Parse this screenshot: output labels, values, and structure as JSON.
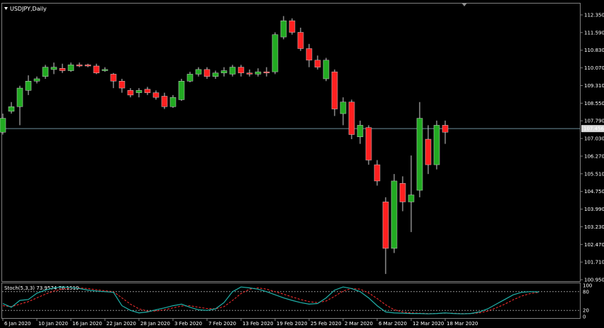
{
  "window": {
    "symbol_label": "USDJPY,Daily",
    "current_price_label": "107.456",
    "colors": {
      "background": "#000000",
      "frame": "#808080",
      "bull": "#22aa22",
      "bear": "#ff2020",
      "wick": "#d0d0d0",
      "price_line": "#6b8e9a",
      "stoch_main": "#20b2aa",
      "stoch_signal": "#ff3030",
      "level_line": "#909090",
      "text": "#ffffff",
      "current_badge_bg": "#d8d8d8",
      "current_badge_text": "#000000"
    }
  },
  "price_axis": {
    "labels": [
      "112.350",
      "111.590",
      "110.830",
      "110.070",
      "109.310",
      "108.550",
      "107.790",
      "107.456",
      "107.030",
      "106.270",
      "105.510",
      "104.750",
      "103.990",
      "103.230",
      "102.470",
      "101.710",
      "100.950"
    ],
    "min": 100.95,
    "max": 112.35,
    "current_price": 107.456
  },
  "date_axis": {
    "labels": [
      "6 Jan 2020",
      "10 Jan 2020",
      "16 Jan 2020",
      "22 Jan 2020",
      "28 Jan 2020",
      "3 Feb 2020",
      "7 Feb 2020",
      "13 Feb 2020",
      "19 Feb 2020",
      "25 Feb 2020",
      "2 Mar 2020",
      "6 Mar 2020",
      "12 Mar 2020",
      "18 Mar 2020"
    ],
    "label_bar_index": [
      0,
      4,
      8,
      12,
      16,
      20,
      24,
      28,
      32,
      36,
      40,
      44,
      48,
      52
    ]
  },
  "stochastic": {
    "label": "Stoch(5,3,3) 73.9574 76.1519",
    "levels_labels": [
      "100",
      "80",
      "20",
      "0"
    ],
    "upper_level": 80,
    "lower_level": 20,
    "main": [
      42,
      30,
      52,
      55,
      75,
      85,
      92,
      95,
      93,
      90,
      85,
      82,
      80,
      78,
      35,
      20,
      12,
      15,
      22,
      28,
      35,
      40,
      30,
      22,
      20,
      25,
      45,
      80,
      95,
      92,
      88,
      80,
      70,
      60,
      52,
      45,
      40,
      42,
      60,
      85,
      95,
      90,
      80,
      60,
      35,
      15,
      12,
      11,
      10,
      10,
      9,
      10,
      12,
      10,
      9,
      10,
      15,
      25,
      40,
      55,
      70,
      78,
      80,
      79
    ],
    "signal": [
      35,
      32,
      40,
      48,
      60,
      72,
      82,
      88,
      92,
      92,
      90,
      86,
      83,
      80,
      60,
      40,
      25,
      18,
      18,
      22,
      28,
      34,
      35,
      30,
      26,
      25,
      32,
      52,
      74,
      88,
      92,
      88,
      80,
      72,
      63,
      55,
      48,
      45,
      50,
      65,
      82,
      90,
      88,
      76,
      58,
      38,
      22,
      15,
      12,
      11,
      10,
      10,
      11,
      11,
      10,
      10,
      12,
      18,
      28,
      40,
      54,
      66,
      74,
      78
    ]
  },
  "chart_data": {
    "type": "candlestick",
    "title": "USDJPY,Daily",
    "ylim": [
      100.95,
      112.35
    ],
    "current_price": 107.456,
    "candles": [
      {
        "o": 107.3,
        "h": 108.1,
        "l": 107.2,
        "c": 107.9
      },
      {
        "o": 108.2,
        "h": 108.6,
        "l": 108.1,
        "c": 108.4
      },
      {
        "o": 108.4,
        "h": 109.3,
        "l": 107.6,
        "c": 109.2
      },
      {
        "o": 109.1,
        "h": 109.75,
        "l": 108.9,
        "c": 109.5
      },
      {
        "o": 109.5,
        "h": 109.7,
        "l": 109.4,
        "c": 109.6
      },
      {
        "o": 109.7,
        "h": 110.2,
        "l": 109.6,
        "c": 110.1
      },
      {
        "o": 110.0,
        "h": 110.3,
        "l": 109.8,
        "c": 110.1
      },
      {
        "o": 110.05,
        "h": 110.25,
        "l": 109.85,
        "c": 109.95
      },
      {
        "o": 109.95,
        "h": 110.3,
        "l": 109.9,
        "c": 110.2
      },
      {
        "o": 110.2,
        "h": 110.3,
        "l": 110.1,
        "c": 110.15
      },
      {
        "o": 110.2,
        "h": 110.25,
        "l": 110.1,
        "c": 110.15
      },
      {
        "o": 110.15,
        "h": 110.25,
        "l": 109.8,
        "c": 109.85
      },
      {
        "o": 109.95,
        "h": 110.1,
        "l": 109.9,
        "c": 110.0
      },
      {
        "o": 109.8,
        "h": 109.85,
        "l": 109.2,
        "c": 109.5
      },
      {
        "o": 109.5,
        "h": 109.6,
        "l": 109.0,
        "c": 109.2
      },
      {
        "o": 109.1,
        "h": 109.2,
        "l": 108.8,
        "c": 108.9
      },
      {
        "o": 109.0,
        "h": 109.2,
        "l": 108.8,
        "c": 109.1
      },
      {
        "o": 109.15,
        "h": 109.25,
        "l": 108.9,
        "c": 109.0
      },
      {
        "o": 109.0,
        "h": 109.1,
        "l": 108.7,
        "c": 108.8
      },
      {
        "o": 108.85,
        "h": 109.0,
        "l": 108.3,
        "c": 108.4
      },
      {
        "o": 108.4,
        "h": 108.9,
        "l": 108.35,
        "c": 108.8
      },
      {
        "o": 108.7,
        "h": 109.6,
        "l": 108.65,
        "c": 109.5
      },
      {
        "o": 109.5,
        "h": 109.9,
        "l": 109.45,
        "c": 109.8
      },
      {
        "o": 109.8,
        "h": 110.1,
        "l": 109.7,
        "c": 110.0
      },
      {
        "o": 110.0,
        "h": 110.1,
        "l": 109.6,
        "c": 109.7
      },
      {
        "o": 109.7,
        "h": 109.95,
        "l": 109.6,
        "c": 109.85
      },
      {
        "o": 109.85,
        "h": 110.1,
        "l": 109.7,
        "c": 109.95
      },
      {
        "o": 109.8,
        "h": 110.2,
        "l": 109.7,
        "c": 110.1
      },
      {
        "o": 110.1,
        "h": 110.2,
        "l": 109.7,
        "c": 109.85
      },
      {
        "o": 109.85,
        "h": 110.0,
        "l": 109.7,
        "c": 109.8
      },
      {
        "o": 109.8,
        "h": 110.05,
        "l": 109.7,
        "c": 109.9
      },
      {
        "o": 109.9,
        "h": 110.1,
        "l": 109.7,
        "c": 109.85
      },
      {
        "o": 109.9,
        "h": 111.6,
        "l": 109.8,
        "c": 111.5
      },
      {
        "o": 111.4,
        "h": 112.3,
        "l": 111.3,
        "c": 112.1
      },
      {
        "o": 112.1,
        "h": 112.2,
        "l": 111.5,
        "c": 111.6
      },
      {
        "o": 111.6,
        "h": 111.8,
        "l": 110.8,
        "c": 110.9
      },
      {
        "o": 110.9,
        "h": 111.1,
        "l": 110.1,
        "c": 110.4
      },
      {
        "o": 110.4,
        "h": 110.6,
        "l": 110.0,
        "c": 110.1
      },
      {
        "o": 109.6,
        "h": 110.5,
        "l": 109.5,
        "c": 110.4
      },
      {
        "o": 109.9,
        "h": 110.0,
        "l": 108.0,
        "c": 108.3
      },
      {
        "o": 108.1,
        "h": 108.8,
        "l": 107.6,
        "c": 108.6
      },
      {
        "o": 108.6,
        "h": 108.7,
        "l": 107.0,
        "c": 107.2
      },
      {
        "o": 107.1,
        "h": 107.8,
        "l": 106.8,
        "c": 107.6
      },
      {
        "o": 107.5,
        "h": 107.6,
        "l": 105.9,
        "c": 106.1
      },
      {
        "o": 105.9,
        "h": 106.1,
        "l": 105.0,
        "c": 105.2
      },
      {
        "o": 104.3,
        "h": 104.5,
        "l": 101.2,
        "c": 102.3
      },
      {
        "o": 102.3,
        "h": 105.5,
        "l": 102.1,
        "c": 105.2
      },
      {
        "o": 105.1,
        "h": 105.4,
        "l": 103.9,
        "c": 104.3
      },
      {
        "o": 104.3,
        "h": 106.3,
        "l": 103.0,
        "c": 104.6
      },
      {
        "o": 104.8,
        "h": 108.6,
        "l": 104.5,
        "c": 107.9
      },
      {
        "o": 107.0,
        "h": 107.6,
        "l": 105.5,
        "c": 105.9
      },
      {
        "o": 105.9,
        "h": 107.8,
        "l": 105.7,
        "c": 107.6
      },
      {
        "o": 107.6,
        "h": 107.8,
        "l": 106.8,
        "c": 107.3
      }
    ]
  }
}
